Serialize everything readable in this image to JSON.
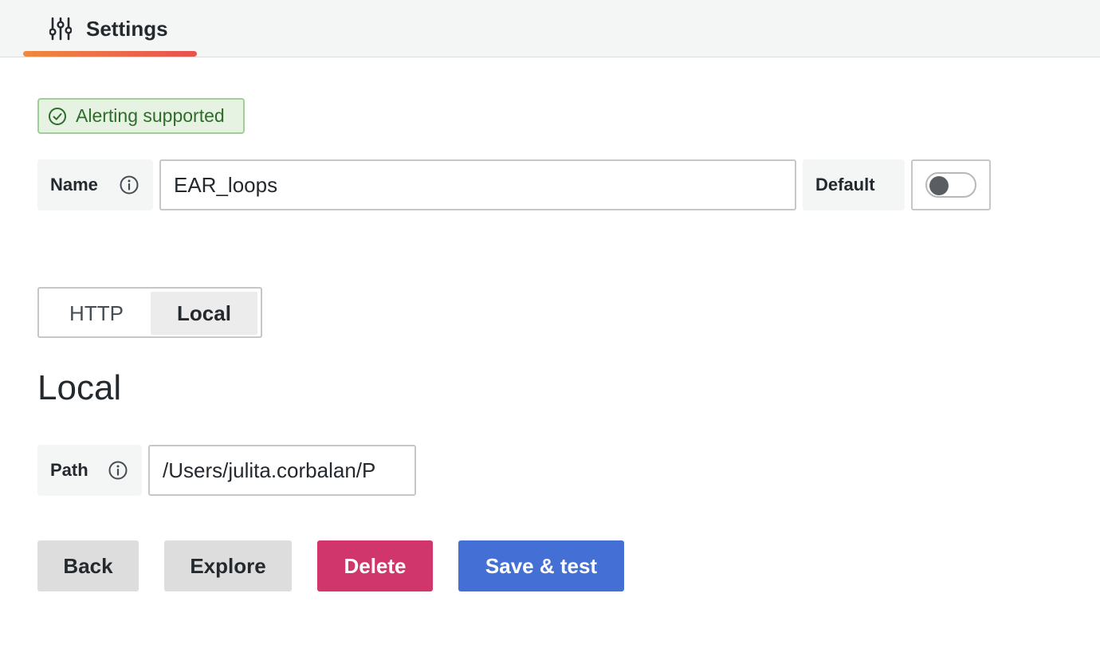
{
  "tabs": [
    {
      "label": "Settings",
      "icon": "sliders-icon",
      "active": true
    }
  ],
  "alerting_badge": {
    "label": "Alerting supported",
    "icon": "check-circle-icon",
    "color": "#2e6d2a"
  },
  "name_field": {
    "label": "Name",
    "value": "EAR_loops",
    "info_icon": "info-icon"
  },
  "default_toggle": {
    "label": "Default",
    "checked": false
  },
  "access_mode": {
    "options": [
      "HTTP",
      "Local"
    ],
    "selected": "Local"
  },
  "section": {
    "heading": "Local"
  },
  "path_field": {
    "label": "Path",
    "value": "/Users/julita.corbalan/P",
    "info_icon": "info-icon"
  },
  "actions": {
    "back": "Back",
    "explore": "Explore",
    "delete": "Delete",
    "save": "Save & test"
  },
  "colors": {
    "accent_gradient_start": "#f0883e",
    "accent_gradient_end": "#e8514f",
    "delete": "#d0366b",
    "primary": "#4470d6",
    "success": "#2e6d2a"
  }
}
